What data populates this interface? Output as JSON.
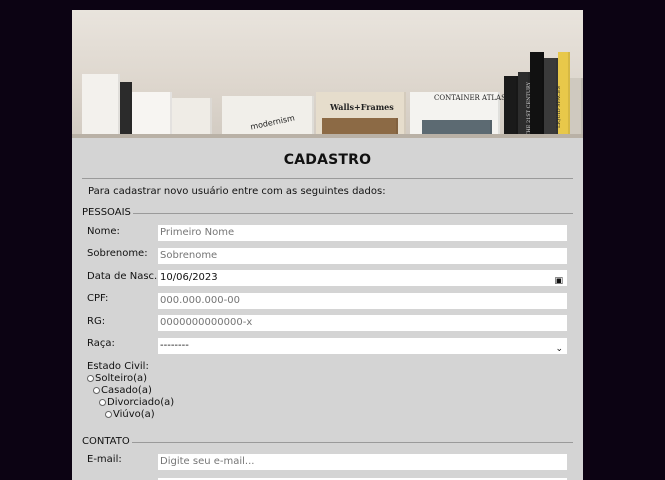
{
  "banner": {
    "book_titles": [
      "Walls+Frames",
      "modernism",
      "CONTAINER ATLAS",
      "THE 21ST CENTURY",
      "LIQUID SPACES"
    ]
  },
  "title": "CADASTRO",
  "intro": "Para cadastrar novo usuário entre com as seguintes dados:",
  "sections": {
    "pessoais": "PESSOAIS",
    "contato": "CONTATO"
  },
  "fields": {
    "nome": {
      "label": "Nome:",
      "placeholder": "Primeiro Nome"
    },
    "sobrenome": {
      "label": "Sobrenome:",
      "placeholder": "Sobrenome"
    },
    "nascimento": {
      "label": "Data de Nasc.:",
      "value": "10/06/2023"
    },
    "cpf": {
      "label": "CPF:",
      "placeholder": "000.000.000-00"
    },
    "rg": {
      "label": "RG:",
      "placeholder": "0000000000000-x"
    },
    "raca": {
      "label": "Raça:",
      "selected": "--------"
    },
    "estado_civil": {
      "label": "Estado Civil:",
      "options": [
        "Solteiro(a)",
        "Casado(a)",
        "Divorciado(a)",
        "Viúvo(a)"
      ]
    },
    "email": {
      "label": "E-mail:",
      "placeholder": "Digite seu e-mail..."
    }
  },
  "colors": {
    "page_bg": "#0c0313",
    "card_bg": "#d4d4d4"
  }
}
